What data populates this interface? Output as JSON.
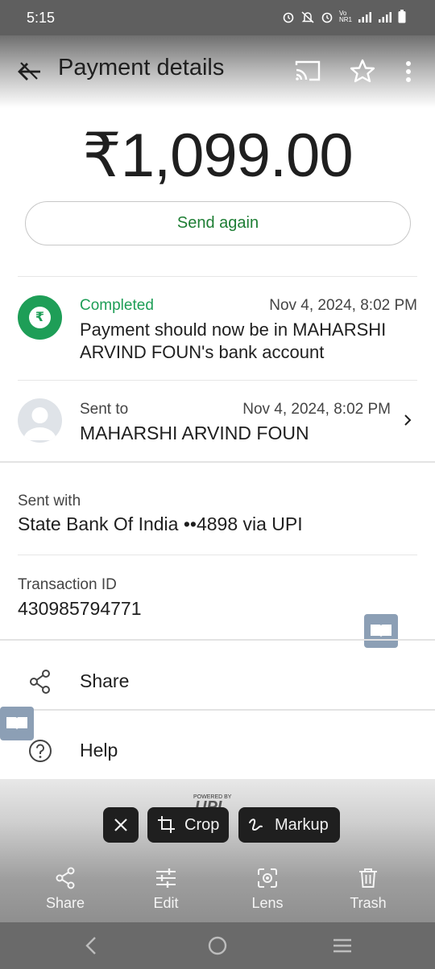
{
  "status_bar": {
    "time": "5:15",
    "network_label": "Vo NR1"
  },
  "app_bar": {
    "title": "Payment details"
  },
  "amount": "₹1,099.00",
  "send_again_label": "Send again",
  "status": {
    "label": "Completed",
    "date": "Nov 4, 2024, 8:02 PM",
    "message": "Payment should now be in MAHARSHI ARVIND FOUN's bank account",
    "icon_glyph": "₹"
  },
  "sent_to": {
    "label": "Sent to",
    "date": "Nov 4, 2024, 8:02 PM",
    "name": "MAHARSHI ARVIND FOUN"
  },
  "sent_with": {
    "label": "Sent with",
    "value": "State Bank Of India ••4898 via UPI"
  },
  "transaction": {
    "label": "Transaction ID",
    "value": "430985794771"
  },
  "actions": {
    "share_label": "Share",
    "help_label": "Help"
  },
  "upi_badge": {
    "powered_by": "POWERED BY",
    "brand": "UPI"
  },
  "viewer_chips": {
    "crop_label": "Crop",
    "markup_label": "Markup"
  },
  "viewer_toolbar": {
    "share_label": "Share",
    "edit_label": "Edit",
    "lens_label": "Lens",
    "trash_label": "Trash"
  },
  "colors": {
    "accent_green": "#1e9e57",
    "send_again_text": "#1e7e34",
    "chip_bg": "#1f1f1f"
  },
  "icons": [
    "back-arrow",
    "cast",
    "star",
    "more-vert",
    "rupee-check",
    "avatar",
    "chevron-right",
    "share",
    "help",
    "crop",
    "markup",
    "edit",
    "lens",
    "trash",
    "close",
    "nav-back",
    "nav-home",
    "nav-recents",
    "reader-mode"
  ]
}
